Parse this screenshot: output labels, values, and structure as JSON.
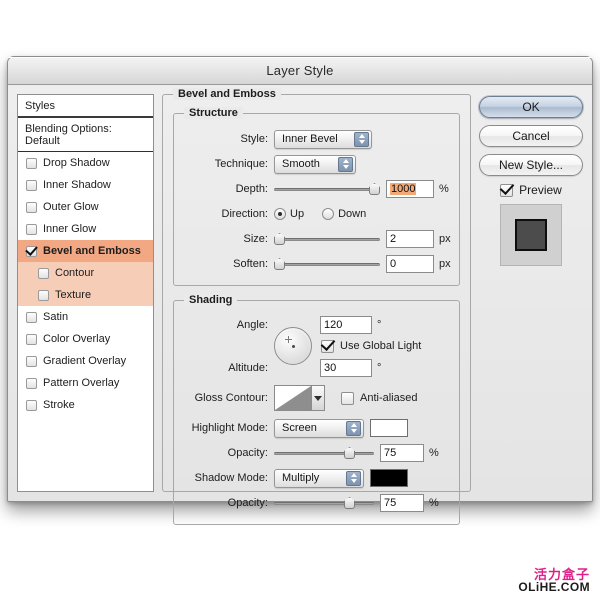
{
  "window": {
    "title": "Layer Style"
  },
  "styles_panel": {
    "header": "Styles",
    "blending_options": "Blending Options: Default",
    "effects": [
      {
        "label": "Drop Shadow",
        "checked": false,
        "sub": false,
        "selected": false
      },
      {
        "label": "Inner Shadow",
        "checked": false,
        "sub": false,
        "selected": false
      },
      {
        "label": "Outer Glow",
        "checked": false,
        "sub": false,
        "selected": false
      },
      {
        "label": "Inner Glow",
        "checked": false,
        "sub": false,
        "selected": false
      },
      {
        "label": "Bevel and Emboss",
        "checked": true,
        "sub": false,
        "selected": true
      },
      {
        "label": "Contour",
        "checked": false,
        "sub": true,
        "selected": true
      },
      {
        "label": "Texture",
        "checked": false,
        "sub": true,
        "selected": true
      },
      {
        "label": "Satin",
        "checked": false,
        "sub": false,
        "selected": false
      },
      {
        "label": "Color Overlay",
        "checked": false,
        "sub": false,
        "selected": false
      },
      {
        "label": "Gradient Overlay",
        "checked": false,
        "sub": false,
        "selected": false
      },
      {
        "label": "Pattern Overlay",
        "checked": false,
        "sub": false,
        "selected": false
      },
      {
        "label": "Stroke",
        "checked": false,
        "sub": false,
        "selected": false
      }
    ]
  },
  "main": {
    "group_title": "Bevel and Emboss",
    "structure": {
      "legend": "Structure",
      "style_label": "Style:",
      "style_value": "Inner Bevel",
      "technique_label": "Technique:",
      "technique_value": "Smooth",
      "depth_label": "Depth:",
      "depth_value": "1000",
      "depth_unit": "%",
      "direction_label": "Direction:",
      "direction_up": "Up",
      "direction_down": "Down",
      "size_label": "Size:",
      "size_value": "2",
      "size_unit": "px",
      "soften_label": "Soften:",
      "soften_value": "0",
      "soften_unit": "px"
    },
    "shading": {
      "legend": "Shading",
      "angle_label": "Angle:",
      "angle_value": "120",
      "angle_unit": "°",
      "use_global_light": "Use Global Light",
      "altitude_label": "Altitude:",
      "altitude_value": "30",
      "altitude_unit": "°",
      "gloss_contour_label": "Gloss Contour:",
      "anti_aliased": "Anti-aliased",
      "highlight_mode_label": "Highlight Mode:",
      "highlight_mode_value": "Screen",
      "highlight_color": "#ffffff",
      "highlight_opacity_label": "Opacity:",
      "highlight_opacity_value": "75",
      "highlight_opacity_unit": "%",
      "shadow_mode_label": "Shadow Mode:",
      "shadow_mode_value": "Multiply",
      "shadow_color": "#000000",
      "shadow_opacity_label": "Opacity:",
      "shadow_opacity_value": "75",
      "shadow_opacity_unit": "%"
    }
  },
  "buttons": {
    "ok": "OK",
    "cancel": "Cancel",
    "new_style": "New Style...",
    "preview": "Preview"
  },
  "watermark": {
    "cn": "活力盒子",
    "en": "OLiHE.COM"
  },
  "colors": {
    "selection_highlight": "#f3a877",
    "row_selected": "#f2a882",
    "row_sub_selected": "#f6cdb7",
    "watermark_pink": "#e0218a"
  }
}
